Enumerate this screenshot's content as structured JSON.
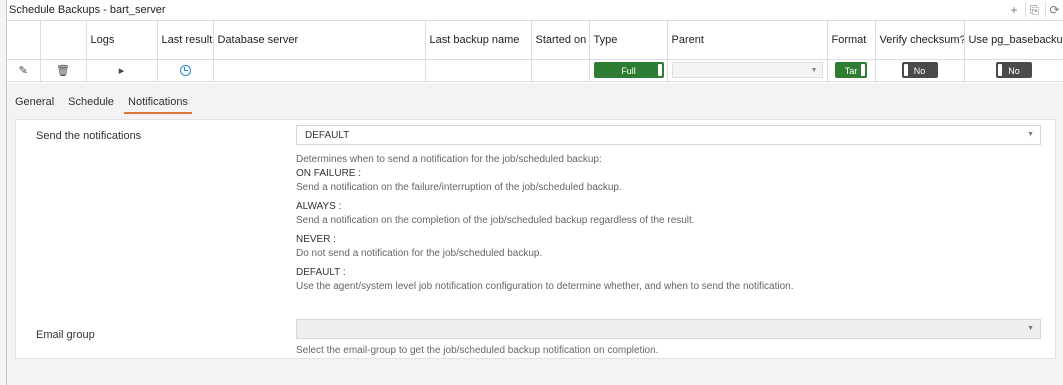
{
  "title": "Schedule Backups - bart_server",
  "toolbar": {
    "add_icon": "+",
    "save_icon": "⎘",
    "refresh_icon": "⟳"
  },
  "grid": {
    "headers": {
      "logs": "Logs",
      "last_result": "Last result",
      "database_server": "Database server",
      "last_backup_name": "Last backup name",
      "started_on": "Started on",
      "type": "Type",
      "parent": "Parent",
      "format": "Format",
      "verify_checksum": "Verify checksum?",
      "use_pg_basebackup": "Use pg_basebackup?"
    },
    "row": {
      "edit_icon": "✎",
      "delete_icon": "🗑",
      "expand_icon": "▸",
      "database_server": "",
      "last_backup_name": "",
      "started_on": "",
      "type": "Full",
      "parent": "",
      "parent_caret": "▼",
      "format": "Tar",
      "verify_checksum": "No",
      "use_pg_basebackup": "No"
    }
  },
  "tabs": [
    {
      "label": "General"
    },
    {
      "label": "Schedule"
    },
    {
      "label": "Notifications",
      "active": true
    }
  ],
  "notifications": {
    "send_label": "Send the notifications",
    "send_value": "DEFAULT",
    "caret": "▼",
    "help_intro": "Determines when to send a notification for the job/scheduled backup:",
    "options": [
      {
        "name": "ON FAILURE :",
        "desc": "Send a notification on the failure/interruption of the job/scheduled backup."
      },
      {
        "name": "ALWAYS :",
        "desc": "Send a notification on the completion of the job/scheduled backup regardless of the result."
      },
      {
        "name": "NEVER :",
        "desc": "Do not send a notification for the job/scheduled backup."
      },
      {
        "name": "DEFAULT :",
        "desc": "Use the agent/system level job notification configuration to determine whether, and when to send the notification."
      }
    ],
    "email_group_label": "Email group",
    "email_group_value": "",
    "email_group_help": "Select the email-group to get the job/scheduled backup notification on completion."
  },
  "colors": {
    "toggle_on": "#2e7d32",
    "toggle_off": "#4a4a4a",
    "tab_active": "#e0753e",
    "clock": "#2a87c8"
  }
}
